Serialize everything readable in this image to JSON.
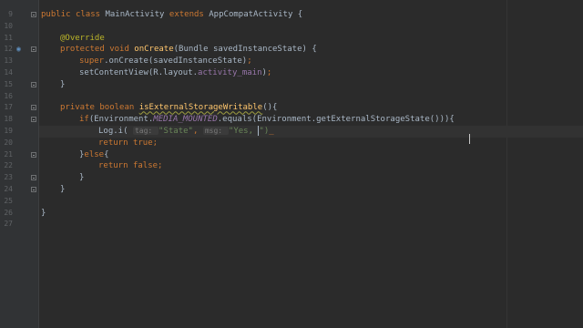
{
  "editor": {
    "lines": [
      {
        "n": "9",
        "tokens": [
          {
            "t": "public ",
            "c": "kw"
          },
          {
            "t": "class ",
            "c": "kw"
          },
          {
            "t": "MainActivity ",
            "c": ""
          },
          {
            "t": "extends ",
            "c": "kw"
          },
          {
            "t": "AppCompatActivity {",
            "c": ""
          }
        ],
        "indent": 0
      },
      {
        "n": "10",
        "tokens": [],
        "indent": 0
      },
      {
        "n": "11",
        "tokens": [
          {
            "t": "@Override",
            "c": "an"
          }
        ],
        "indent": 1
      },
      {
        "n": "12",
        "tokens": [
          {
            "t": "protected ",
            "c": "kw"
          },
          {
            "t": "void ",
            "c": "kw"
          },
          {
            "t": "onCreate",
            "c": "fn"
          },
          {
            "t": "(Bundle savedInstanceState) {",
            "c": ""
          }
        ],
        "indent": 1
      },
      {
        "n": "13",
        "tokens": [
          {
            "t": "super",
            "c": "kw"
          },
          {
            "t": ".onCreate(savedInstanceState)",
            "c": ""
          },
          {
            "t": ";",
            "c": "kw"
          }
        ],
        "indent": 2
      },
      {
        "n": "14",
        "tokens": [
          {
            "t": "setContentView(R.layout.",
            "c": ""
          },
          {
            "t": "activity_main",
            "c": "res"
          },
          {
            "t": ")",
            "c": ""
          },
          {
            "t": ";",
            "c": "kw"
          }
        ],
        "indent": 2
      },
      {
        "n": "15",
        "tokens": [
          {
            "t": "}",
            "c": ""
          }
        ],
        "indent": 1
      },
      {
        "n": "16",
        "tokens": [],
        "indent": 0
      },
      {
        "n": "17",
        "tokens": [
          {
            "t": "private ",
            "c": "kw"
          },
          {
            "t": "boolean ",
            "c": "kw"
          },
          {
            "t": "isExternalStorageWritable",
            "c": "fn warn"
          },
          {
            "t": "(){",
            "c": ""
          }
        ],
        "indent": 1
      },
      {
        "n": "18",
        "tokens": [
          {
            "t": "if",
            "c": "kw"
          },
          {
            "t": "(Environment.",
            "c": ""
          },
          {
            "t": "MEDIA_MOUNTED",
            "c": "fld"
          },
          {
            "t": ".equals(Environment.getExternalStorageState())){",
            "c": ""
          }
        ],
        "indent": 2
      },
      {
        "n": "19",
        "tokens": [
          {
            "t": "Log.i( ",
            "c": ""
          },
          {
            "t": "tag: ",
            "c": "hint"
          },
          {
            "t": "\"State\"",
            "c": "st"
          },
          {
            "t": ", ",
            "c": "kw"
          },
          {
            "t": "msg: ",
            "c": "hint"
          },
          {
            "t": "\"Yes, ",
            "c": "st"
          },
          {
            "t": "CARET",
            "c": "caret"
          },
          {
            "t": "\")",
            "c": "st"
          },
          {
            "t": "_",
            "c": "kw"
          }
        ],
        "indent": 3
      },
      {
        "n": "20",
        "tokens": [
          {
            "t": "return ",
            "c": "kw"
          },
          {
            "t": "true",
            "c": "kw"
          },
          {
            "t": ";",
            "c": "kw"
          }
        ],
        "indent": 3
      },
      {
        "n": "21",
        "tokens": [
          {
            "t": "}",
            "c": ""
          },
          {
            "t": "else",
            "c": "kw"
          },
          {
            "t": "{",
            "c": ""
          }
        ],
        "indent": 2
      },
      {
        "n": "22",
        "tokens": [
          {
            "t": "return ",
            "c": "kw"
          },
          {
            "t": "false",
            "c": "kw"
          },
          {
            "t": ";",
            "c": "kw"
          }
        ],
        "indent": 3
      },
      {
        "n": "23",
        "tokens": [
          {
            "t": "}",
            "c": ""
          }
        ],
        "indent": 2
      },
      {
        "n": "24",
        "tokens": [
          {
            "t": "}",
            "c": ""
          }
        ],
        "indent": 1
      },
      {
        "n": "25",
        "tokens": [],
        "indent": 0
      },
      {
        "n": "26",
        "tokens": [
          {
            "t": "}",
            "c": ""
          }
        ],
        "indent": 0
      },
      {
        "n": "27",
        "tokens": [],
        "indent": 0
      }
    ],
    "override_icon": "override-method-icon",
    "fold_icon": "fold-marker-icon"
  }
}
